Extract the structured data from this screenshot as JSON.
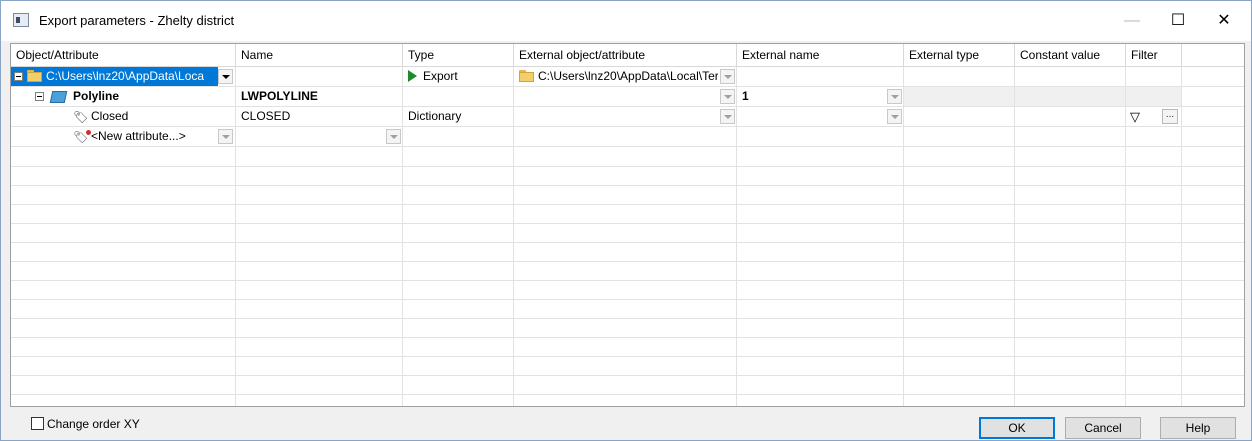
{
  "window": {
    "title": "Export parameters - Zhelty district",
    "min_glyph": "—",
    "max_glyph": "☐",
    "close_glyph": "✕"
  },
  "grid": {
    "columns": [
      "Object/Attribute",
      "Name",
      "Type",
      "External object/attribute",
      "External name",
      "External type",
      "Constant value",
      "Filter"
    ],
    "rows": [
      {
        "object": "C:\\Users\\lnz20\\AppData\\Loca",
        "name": "",
        "type": "Export",
        "external_object": "C:\\Users\\lnz20\\AppData\\Local\\Ter",
        "external_name": "",
        "external_type": "",
        "constant": "",
        "filter": ""
      },
      {
        "object": "Polyline",
        "name": "LWPOLYLINE",
        "type": "",
        "external_object": "",
        "external_name": "1",
        "external_type": "",
        "constant": "",
        "filter": ""
      },
      {
        "object": "Closed",
        "name": "CLOSED",
        "type": "Dictionary",
        "external_object": "",
        "external_name": "",
        "external_type": "",
        "constant": "",
        "filter": "..."
      },
      {
        "object": "<New attribute...>",
        "name": "",
        "type": "",
        "external_object": "",
        "external_name": "",
        "external_type": "",
        "constant": "",
        "filter": ""
      }
    ]
  },
  "footer": {
    "change_order_label": "Change order XY",
    "change_order_checked": false,
    "ok_label": "OK",
    "cancel_label": "Cancel",
    "help_label": "Help"
  },
  "icons": {
    "app": "dialog-icon",
    "folder": "folder-icon",
    "polyline": "polyline-icon",
    "attribute": "tag-icon",
    "new_attribute": "new-attribute-icon",
    "export": "play-icon",
    "filter": "filter-icon"
  },
  "colors": {
    "selection": "#0078d7",
    "export_arrow": "#1e8a2a",
    "folder": "#f4ce6a",
    "polyline": "#4aa0d8"
  }
}
